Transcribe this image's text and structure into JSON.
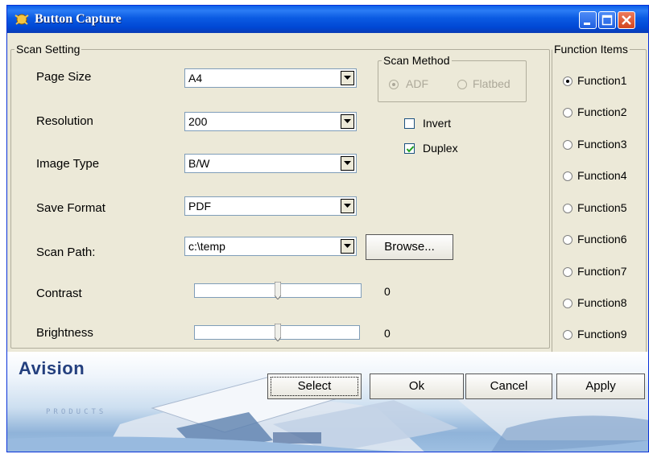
{
  "window": {
    "title": "Button Capture",
    "controls": [
      "minimize",
      "maximize",
      "close"
    ]
  },
  "scan_setting": {
    "legend": "Scan Setting",
    "page_size": {
      "label": "Page Size",
      "value": "A4"
    },
    "resolution": {
      "label": "Resolution",
      "value": "200"
    },
    "image_type": {
      "label": "Image Type",
      "value": "B/W"
    },
    "save_format": {
      "label": "Save Format",
      "value": "PDF"
    },
    "scan_path": {
      "label": "Scan Path:",
      "value": "c:\\temp"
    },
    "browse_label": "Browse...",
    "contrast": {
      "label": "Contrast",
      "value": "0"
    },
    "brightness": {
      "label": "Brightness",
      "value": "0"
    },
    "scan_method": {
      "legend": "Scan Method",
      "adf": "ADF",
      "flatbed": "Flatbed",
      "selected": "ADF",
      "enabled": false
    },
    "invert": {
      "label": "Invert",
      "checked": false
    },
    "duplex": {
      "label": "Duplex",
      "checked": true
    }
  },
  "function_items": {
    "legend": "Function Items",
    "items": [
      "Function1",
      "Function2",
      "Function3",
      "Function4",
      "Function5",
      "Function6",
      "Function7",
      "Function8",
      "Function9"
    ],
    "selected_index": 0
  },
  "banner": {
    "brand": "Avision",
    "sub": "PRODUCTS"
  },
  "buttons": {
    "select": "Select",
    "ok": "Ok",
    "cancel": "Cancel",
    "apply": "Apply"
  },
  "colors": {
    "titlebar": "#0a5ee8",
    "window_bg": "#ece9d8",
    "brand": "#233f7e"
  }
}
